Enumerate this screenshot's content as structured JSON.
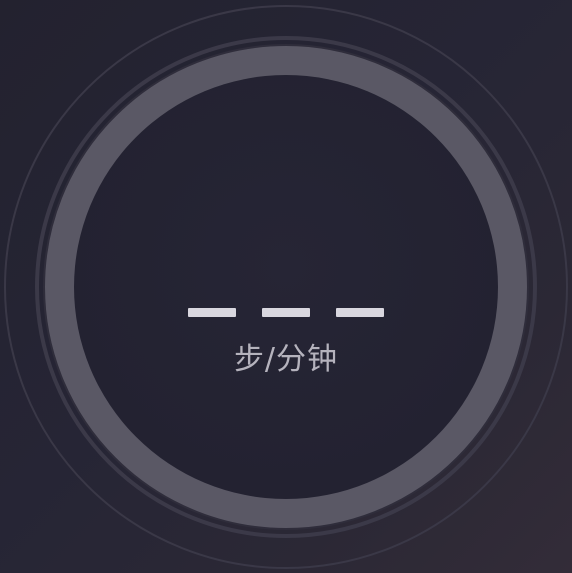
{
  "cadence": {
    "value_placeholder": [
      "—",
      "—",
      "—"
    ],
    "unit_label": "步/分钟",
    "progress": 0
  },
  "colors": {
    "background": "#242332",
    "track": "#5a5865",
    "text": "#d9d7df",
    "unit_text": "#b5b3bd"
  }
}
